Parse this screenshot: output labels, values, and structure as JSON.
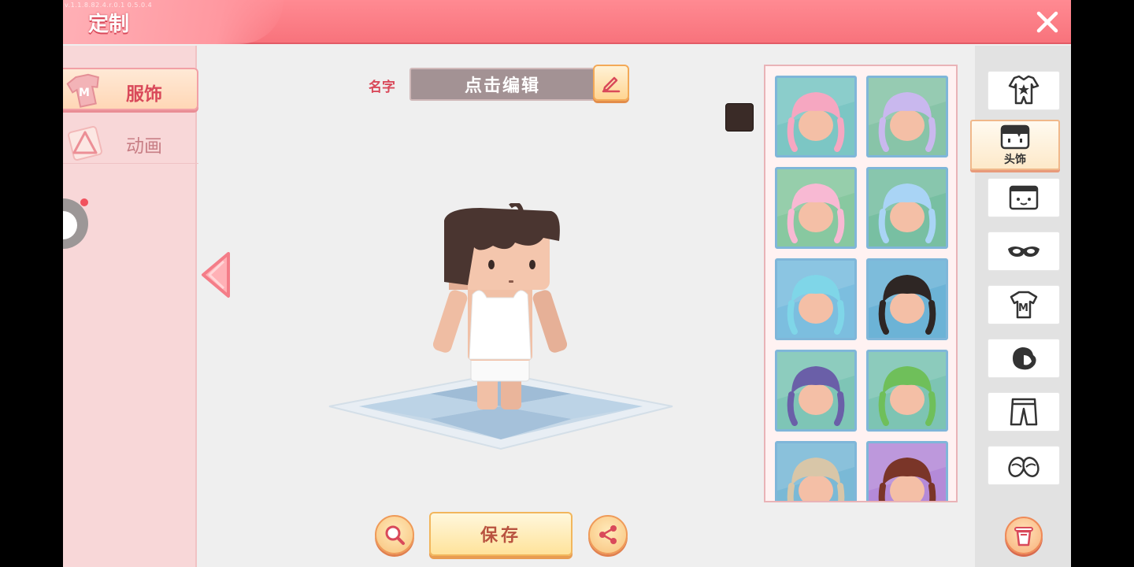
{
  "header": {
    "title": "定制",
    "build_info": "v.1.1.8.82.4.r.0.1 0.5.0.4"
  },
  "left_panel": {
    "tabs": [
      {
        "label": "服饰",
        "active": true
      },
      {
        "label": "动画",
        "active": false
      }
    ]
  },
  "editor": {
    "name_label": "名字",
    "name_placeholder": "点击编辑",
    "hair_color": "#3a2b27"
  },
  "actions": {
    "save_label": "保存"
  },
  "item_grid": {
    "items": [
      {
        "name": "pink-pigtail-hair",
        "bg": "#7cc6c4"
      },
      {
        "name": "lavender-twin-tail-hair",
        "bg": "#88c4a8"
      },
      {
        "name": "pink-braid-hair",
        "bg": "#88c8a0"
      },
      {
        "name": "pink-blue-curl-hair",
        "bg": "#78bfa2"
      },
      {
        "name": "candle-cake-hair",
        "bg": "#7cbedf"
      },
      {
        "name": "long-black-hair",
        "bg": "#6cb3d6"
      },
      {
        "name": "zigzag-helmet",
        "bg": "#7ec5b6"
      },
      {
        "name": "green-crown-fish-hair",
        "bg": "#7dc4b3"
      },
      {
        "name": "beanie-hat",
        "bg": "#7ab9d6"
      },
      {
        "name": "bun-red-hair",
        "bg": "#b48ad8"
      }
    ]
  },
  "right_rail": {
    "active_label": "头饰",
    "categories": [
      "outfit",
      "head",
      "face",
      "mask",
      "shirt",
      "hand",
      "pants",
      "shoes"
    ]
  }
}
